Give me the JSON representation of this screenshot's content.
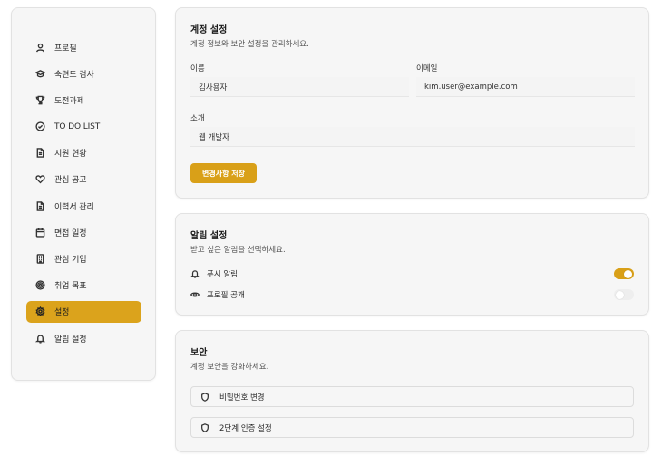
{
  "sidebar": {
    "items": [
      {
        "label": "프로필",
        "icon": "user-icon",
        "active": false
      },
      {
        "label": "숙련도 검사",
        "icon": "graduation-cap-icon",
        "active": false
      },
      {
        "label": "도전과제",
        "icon": "trophy-icon",
        "active": false
      },
      {
        "label": "TO DO LIST",
        "icon": "check-circle-icon",
        "active": false
      },
      {
        "label": "지원 현황",
        "icon": "document-icon",
        "active": false
      },
      {
        "label": "관심 공고",
        "icon": "heart-icon",
        "active": false
      },
      {
        "label": "이력서 관리",
        "icon": "document-icon",
        "active": false
      },
      {
        "label": "면접 일정",
        "icon": "calendar-icon",
        "active": false
      },
      {
        "label": "관심 기업",
        "icon": "building-icon",
        "active": false
      },
      {
        "label": "취업 목표",
        "icon": "target-icon",
        "active": false
      },
      {
        "label": "설정",
        "icon": "gear-icon",
        "active": true
      },
      {
        "label": "알림 설정",
        "icon": "bell-icon",
        "active": false
      }
    ]
  },
  "account": {
    "title": "계정 설정",
    "subtitle": "계정 정보와 보안 설정을 관리하세요.",
    "name_label": "이름",
    "name_value": "김사용자",
    "email_label": "이메일",
    "email_value": "kim.user@example.com",
    "bio_label": "소개",
    "bio_value": "웹 개발자",
    "save_label": "변경사항 저장"
  },
  "notifications": {
    "title": "알림 설정",
    "subtitle": "받고 싶은 알림을 선택하세요.",
    "push_label": "푸시 알림",
    "push_on": true,
    "profile_public_label": "프로필 공개",
    "profile_public_on": false
  },
  "security": {
    "title": "보안",
    "subtitle": "계정 보안을 강화하세요.",
    "change_password_label": "비밀번호 변경",
    "two_factor_label": "2단계 인증 설정"
  },
  "colors": {
    "accent": "#d9a018",
    "card_bg": "#f6f6f6",
    "border": "#e2e2e2"
  }
}
